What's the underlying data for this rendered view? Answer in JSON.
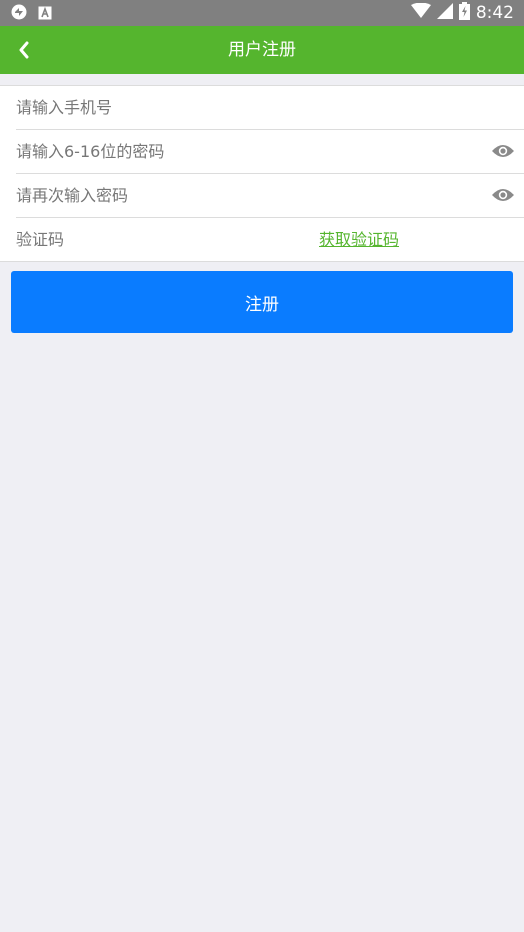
{
  "status_bar": {
    "time": "8:42",
    "icons": [
      "sync-icon",
      "keyboard-a-icon",
      "wifi-icon",
      "signal-icon",
      "battery-charging-icon"
    ]
  },
  "nav": {
    "title": "用户注册",
    "back_icon": "back-chevron-icon"
  },
  "form": {
    "phone_placeholder": "请输入手机号",
    "phone_value": "",
    "password_placeholder": "请输入6-16位的密码",
    "password_value": "",
    "confirm_placeholder": "请再次输入密码",
    "confirm_value": "",
    "code_placeholder": "验证码",
    "code_value": "",
    "get_code_label": "获取验证码",
    "eye_icon": "eye-icon"
  },
  "submit_label": "注册",
  "colors": {
    "status_bar": "#808080",
    "nav_bar": "#55b52e",
    "page_bg": "#efeff4",
    "link": "#55b52e",
    "primary_button": "#0a7cff",
    "eye_icon": "#8a8a8a"
  }
}
